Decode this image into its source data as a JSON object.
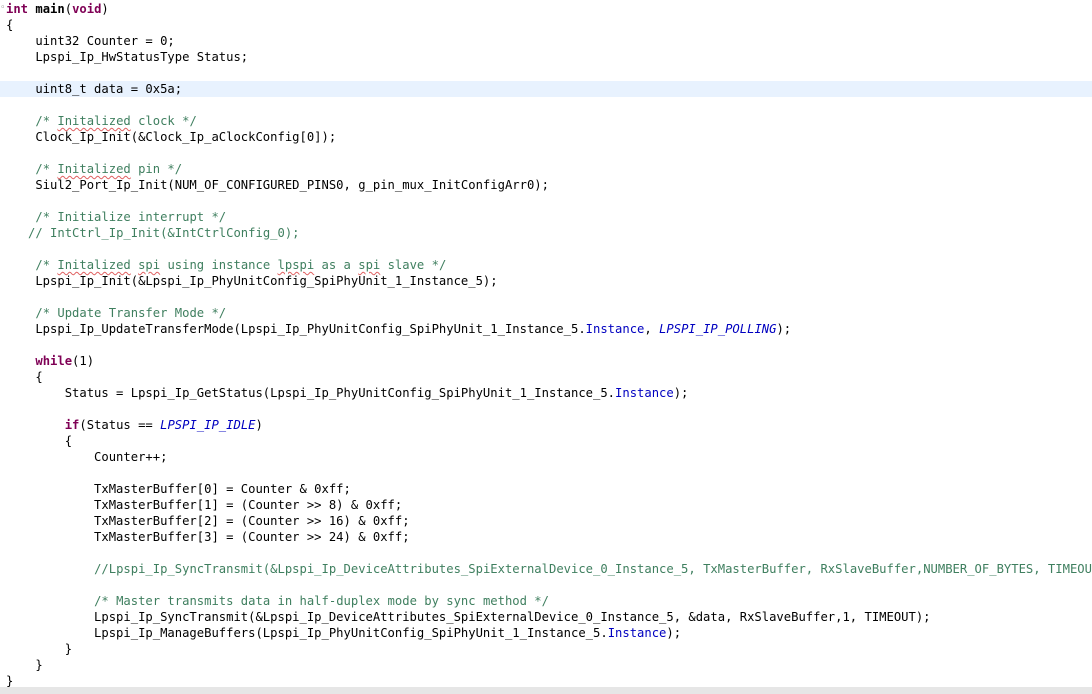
{
  "editor": {
    "language": "C",
    "current_line_index": 4,
    "lines": [
      {
        "segments": [
          {
            "t": "int",
            "c": "kw"
          },
          {
            "t": " "
          },
          {
            "t": "main",
            "c": "bold"
          },
          {
            "t": "("
          },
          {
            "t": "void",
            "c": "kw"
          },
          {
            "t": ")"
          }
        ]
      },
      {
        "segments": [
          {
            "t": "{"
          }
        ]
      },
      {
        "segments": [
          {
            "t": "    uint32 Counter = 0;"
          }
        ]
      },
      {
        "segments": [
          {
            "t": "    Lpspi_Ip_HwStatusType Status;"
          }
        ]
      },
      {
        "segments": [
          {
            "t": "    uint8_t data = 0x5a;"
          }
        ]
      },
      {
        "segments": [
          {
            "t": "    "
          },
          {
            "t": "/* ",
            "c": "cm"
          },
          {
            "t": "Initalized",
            "c": "cm typo"
          },
          {
            "t": " clock */",
            "c": "cm"
          }
        ]
      },
      {
        "segments": [
          {
            "t": "    Clock_Ip_Init(&Clock_Ip_aClockConfig[0]);"
          }
        ]
      },
      {
        "segments": [
          {
            "t": "    "
          },
          {
            "t": "/* ",
            "c": "cm"
          },
          {
            "t": "Initalized",
            "c": "cm typo"
          },
          {
            "t": " pin */",
            "c": "cm"
          }
        ]
      },
      {
        "segments": [
          {
            "t": "    Siul2_Port_Ip_Init(NUM_OF_CONFIGURED_PINS0, g_pin_mux_InitConfigArr0);"
          }
        ]
      },
      {
        "segments": [
          {
            "t": "    "
          },
          {
            "t": "/* Initialize interrupt */",
            "c": "cm"
          }
        ]
      },
      {
        "segments": [
          {
            "t": "   "
          },
          {
            "t": "// IntCtrl_Ip_Init(&IntCtrlConfig_0);",
            "c": "cm"
          }
        ]
      },
      {
        "segments": [
          {
            "t": "    "
          },
          {
            "t": "/* ",
            "c": "cm"
          },
          {
            "t": "Initalized",
            "c": "cm typo"
          },
          {
            "t": " ",
            "c": "cm"
          },
          {
            "t": "spi",
            "c": "cm typo"
          },
          {
            "t": " using instance ",
            "c": "cm"
          },
          {
            "t": "lpspi",
            "c": "cm typo"
          },
          {
            "t": " as a ",
            "c": "cm"
          },
          {
            "t": "spi",
            "c": "cm typo"
          },
          {
            "t": " slave */",
            "c": "cm"
          }
        ]
      },
      {
        "segments": [
          {
            "t": "    Lpspi_Ip_Init(&Lpspi_Ip_PhyUnitConfig_SpiPhyUnit_1_Instance_5);"
          }
        ]
      },
      {
        "segments": [
          {
            "t": "    "
          },
          {
            "t": "/* Update Transfer Mode */",
            "c": "cm"
          }
        ]
      },
      {
        "segments": [
          {
            "t": "    Lpspi_Ip_UpdateTransferMode(Lpspi_Ip_PhyUnitConfig_SpiPhyUnit_1_Instance_5."
          },
          {
            "t": "Instance",
            "c": "field"
          },
          {
            "t": ", "
          },
          {
            "t": "LPSPI_IP_POLLING",
            "c": "enum"
          },
          {
            "t": ");"
          }
        ]
      },
      {
        "segments": [
          {
            "t": "    "
          },
          {
            "t": "while",
            "c": "kw"
          },
          {
            "t": "(1)"
          }
        ]
      },
      {
        "segments": [
          {
            "t": "    {"
          }
        ]
      },
      {
        "segments": [
          {
            "t": "        Status = Lpspi_Ip_GetStatus(Lpspi_Ip_PhyUnitConfig_SpiPhyUnit_1_Instance_5."
          },
          {
            "t": "Instance",
            "c": "field"
          },
          {
            "t": ");"
          }
        ]
      },
      {
        "segments": [
          {
            "t": "        "
          },
          {
            "t": "if",
            "c": "kw"
          },
          {
            "t": "(Status == "
          },
          {
            "t": "LPSPI_IP_IDLE",
            "c": "enum"
          },
          {
            "t": ")"
          }
        ]
      },
      {
        "segments": [
          {
            "t": "        {"
          }
        ]
      },
      {
        "segments": [
          {
            "t": "            Counter++;"
          }
        ]
      },
      {
        "segments": [
          {
            "t": "            TxMasterBuffer[0] = Counter & 0xff;"
          }
        ]
      },
      {
        "segments": [
          {
            "t": "            TxMasterBuffer[1] = (Counter >> 8) & 0xff;"
          }
        ]
      },
      {
        "segments": [
          {
            "t": "            TxMasterBuffer[2] = (Counter >> 16) & 0xff;"
          }
        ]
      },
      {
        "segments": [
          {
            "t": "            TxMasterBuffer[3] = (Counter >> 24) & 0xff;"
          }
        ]
      },
      {
        "segments": [
          {
            "t": "            "
          },
          {
            "t": "//Lpspi_Ip_SyncTransmit(&Lpspi_Ip_DeviceAttributes_SpiExternalDevice_0_Instance_5, TxMasterBuffer, RxSlaveBuffer,NUMBER_OF_BYTES, TIMEOUT);",
            "c": "cm"
          }
        ]
      },
      {
        "segments": [
          {
            "t": "            "
          },
          {
            "t": "/* Master transmits data in half-duplex mode by sync method */",
            "c": "cm"
          }
        ]
      },
      {
        "segments": [
          {
            "t": "            Lpspi_Ip_SyncTransmit(&Lpspi_Ip_DeviceAttributes_SpiExternalDevice_0_Instance_5, &data, RxSlaveBuffer,1, TIMEOUT);"
          }
        ]
      },
      {
        "segments": [
          {
            "t": "            Lpspi_Ip_ManageBuffers(Lpspi_Ip_PhyUnitConfig_SpiPhyUnit_1_Instance_5."
          },
          {
            "t": "Instance",
            "c": "field"
          },
          {
            "t": ");"
          }
        ]
      },
      {
        "segments": [
          {
            "t": "        }"
          }
        ]
      },
      {
        "segments": [
          {
            "t": "    }"
          }
        ]
      },
      {
        "segments": [
          {
            "t": "}"
          }
        ]
      }
    ]
  }
}
